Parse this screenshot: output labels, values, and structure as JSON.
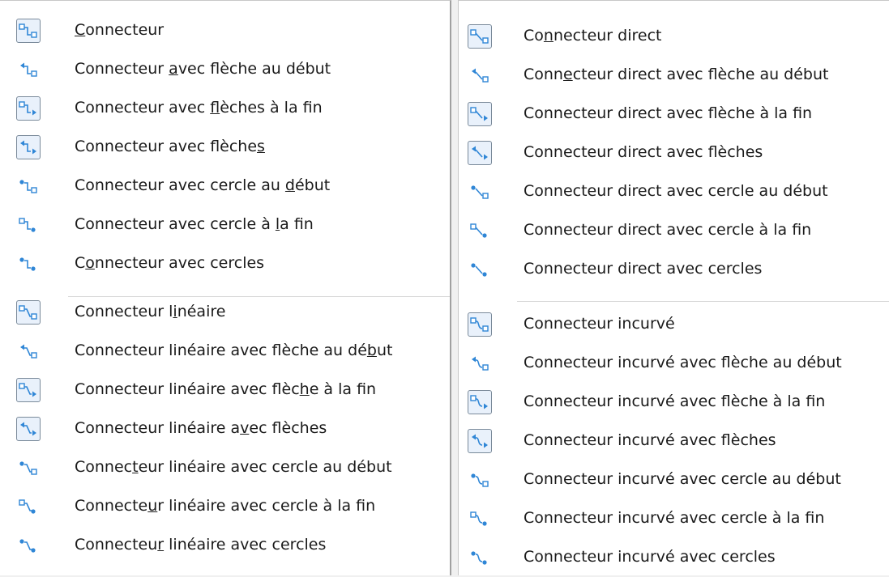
{
  "colors": {
    "icon_blue": "#2f86d6",
    "frame": "#7a8a9a",
    "frame_fill": "#e9f1fb",
    "text": "#1a1a1a"
  },
  "left": {
    "groups": [
      [
        {
          "pre": "",
          "u": "C",
          "post": "onnecteur",
          "icon": "connector-icon",
          "framed": true
        },
        {
          "pre": "Connecteur ",
          "u": "a",
          "post": "vec flèche au début",
          "icon": "connector-arrow-start-icon",
          "framed": false
        },
        {
          "pre": "Connecteur avec ",
          "u": "f",
          "post": "lèches à la fin",
          "icon": "connector-arrow-end-icon",
          "framed": true
        },
        {
          "pre": "Connecteur avec flèche",
          "u": "s",
          "post": "",
          "icon": "connector-arrows-icon",
          "framed": true
        },
        {
          "pre": "Connecteur avec cercle au ",
          "u": "d",
          "post": "ébut",
          "icon": "connector-circle-start-icon",
          "framed": false
        },
        {
          "pre": "Connecteur avec cercle à ",
          "u": "l",
          "post": "a fin",
          "icon": "connector-circle-end-icon",
          "framed": false
        },
        {
          "pre": "C",
          "u": "o",
          "post": "nnecteur avec cercles",
          "icon": "connector-circles-icon",
          "framed": false
        }
      ],
      [
        {
          "pre": "Connecteur l",
          "u": "i",
          "post": "néaire",
          "icon": "line-connector-icon",
          "framed": true
        },
        {
          "pre": "Connecteur linéaire avec flèche au dé",
          "u": "b",
          "post": "ut",
          "icon": "line-connector-arrow-start-icon",
          "framed": false
        },
        {
          "pre": "Connecteur linéaire avec flèc",
          "u": "h",
          "post": "e à la fin",
          "icon": "line-connector-arrow-end-icon",
          "framed": true
        },
        {
          "pre": "Connecteur linéaire a",
          "u": "v",
          "post": "ec flèches",
          "icon": "line-connector-arrows-icon",
          "framed": true
        },
        {
          "pre": "Connec",
          "u": "t",
          "post": "eur linéaire avec cercle au début",
          "icon": "line-connector-circle-start-icon",
          "framed": false
        },
        {
          "pre": "Connecte",
          "u": "u",
          "post": "r linéaire avec cercle à la fin",
          "icon": "line-connector-circle-end-icon",
          "framed": false
        },
        {
          "pre": "Connecteu",
          "u": "r",
          "post": " linéaire avec cercles",
          "icon": "line-connector-circles-icon",
          "framed": false
        }
      ]
    ]
  },
  "right": {
    "groups": [
      [
        {
          "pre": "Co",
          "u": "n",
          "post": "necteur direct",
          "icon": "straight-connector-icon",
          "framed": true
        },
        {
          "pre": "Conn",
          "u": "e",
          "post": "cteur direct avec flèche au début",
          "icon": "straight-connector-arrow-start-icon",
          "framed": false
        },
        {
          "pre": "Connecteur direct avec flèche à la fin",
          "u": "",
          "post": "",
          "icon": "straight-connector-arrow-end-icon",
          "framed": true
        },
        {
          "pre": "Connecteur direct avec flèches",
          "u": "",
          "post": "",
          "icon": "straight-connector-arrows-icon",
          "framed": true
        },
        {
          "pre": "Connecteur direct avec cercle au début",
          "u": "",
          "post": "",
          "icon": "straight-connector-circle-start-icon",
          "framed": false
        },
        {
          "pre": "Connecteur direct avec cercle à la fin",
          "u": "",
          "post": "",
          "icon": "straight-connector-circle-end-icon",
          "framed": false
        },
        {
          "pre": "Connecteur direct avec cercles",
          "u": "",
          "post": "",
          "icon": "straight-connector-circles-icon",
          "framed": false
        }
      ],
      [
        {
          "pre": "Connecteur incurvé",
          "u": "",
          "post": "",
          "icon": "curved-connector-icon",
          "framed": true
        },
        {
          "pre": "Connecteur incurvé avec flèche au début",
          "u": "",
          "post": "",
          "icon": "curved-connector-arrow-start-icon",
          "framed": false
        },
        {
          "pre": "Connecteur incurvé avec flèche à la fin",
          "u": "",
          "post": "",
          "icon": "curved-connector-arrow-end-icon",
          "framed": true
        },
        {
          "pre": "Connecteur incurvé avec flèches",
          "u": "",
          "post": "",
          "icon": "curved-connector-arrows-icon",
          "framed": true
        },
        {
          "pre": "Connecteur incurvé avec cercle au début",
          "u": "",
          "post": "",
          "icon": "curved-connector-circle-start-icon",
          "framed": false
        },
        {
          "pre": "Connecteur incurvé avec cercle à la fin",
          "u": "",
          "post": "",
          "icon": "curved-connector-circle-end-icon",
          "framed": false
        },
        {
          "pre": "Connecteur incurvé avec cercles",
          "u": "",
          "post": "",
          "icon": "curved-connector-circles-icon",
          "framed": false
        }
      ]
    ]
  }
}
